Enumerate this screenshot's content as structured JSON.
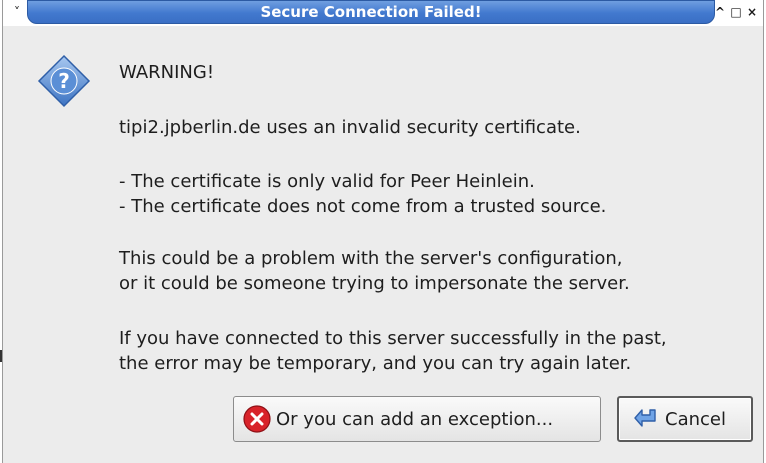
{
  "window": {
    "title": "Secure Connection Failed!",
    "menu_glyph": "˅",
    "controls": {
      "minimize": "^",
      "maximize": "□",
      "close": "×"
    }
  },
  "dialog": {
    "icon": "question-icon",
    "heading": "WARNING!",
    "line1": "tipi2.jpberlin.de uses an invalid security certificate.",
    "bullet1": "- The certificate is only valid for Peer Heinlein.",
    "bullet2": "- The certificate does not come from a trusted source.",
    "problem1": "This could be a problem with the server's configuration,",
    "problem2": "or it could be someone trying to impersonate the server.",
    "past1": "If you have connected to this server successfully in the past,",
    "past2": "the error may be temporary, and you can try again later."
  },
  "buttons": {
    "exception_label": "Or you can add an exception...",
    "exception_icon": "error-x-icon",
    "cancel_label": "Cancel",
    "cancel_icon": "back-arrow-icon"
  },
  "colors": {
    "titlebar": "#4279cf",
    "dialog_bg": "#ececec",
    "error_red": "#d8232a"
  }
}
